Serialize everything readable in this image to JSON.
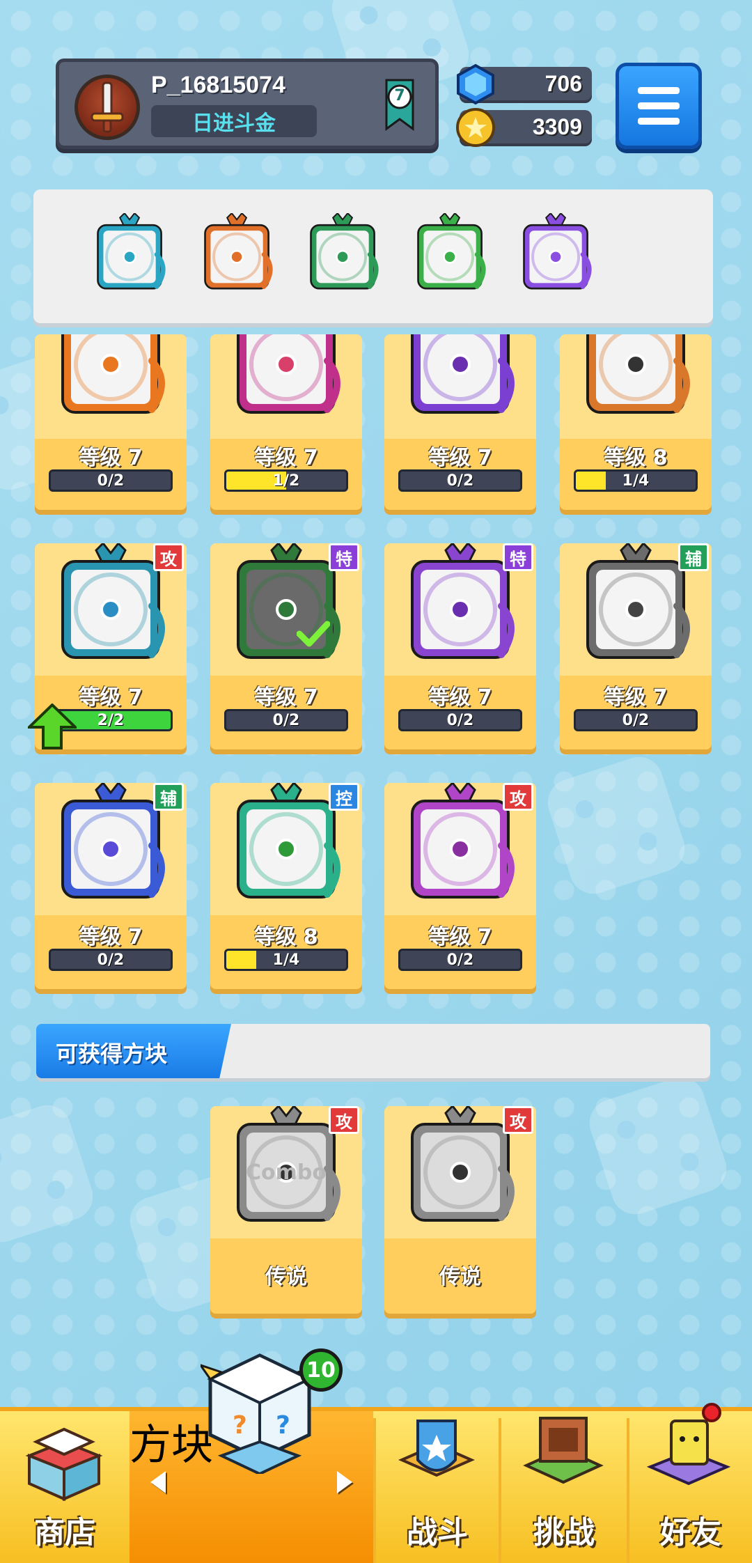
{
  "header": {
    "player_name": "P_16815074",
    "rank_title": "日进斗金",
    "rank_level": "7",
    "gems": "706",
    "coins": "3309"
  },
  "deck": {
    "slots": [
      {
        "name": "teal-dice",
        "color": "#2aa6c4"
      },
      {
        "name": "rainbow-dice",
        "color": "#e0702a"
      },
      {
        "name": "green-dice",
        "color": "#2e9a58"
      },
      {
        "name": "leaf-dice",
        "color": "#3bb048"
      },
      {
        "name": "purple-dice",
        "color": "#8a4ee0"
      }
    ]
  },
  "cards": [
    {
      "level": "等级 7",
      "progress": "0/2",
      "fill": 0,
      "frame": "#e9771f",
      "pip": "#e9771f"
    },
    {
      "level": "等级 7",
      "progress": "1/2",
      "fill": 0.5,
      "frame": "#c02f8a",
      "pip": "#d8406a"
    },
    {
      "level": "等级 7",
      "progress": "0/2",
      "fill": 0,
      "frame": "#7b3fd1",
      "pip": "#6a2fb0"
    },
    {
      "level": "等级 8",
      "progress": "1/4",
      "fill": 0.25,
      "frame": "#d9772a",
      "pip": "#333333"
    },
    {
      "level": "等级 7",
      "progress": "2/2",
      "fill": 1,
      "frame": "#2a95b0",
      "pip": "#2a8ec4",
      "tag": "攻",
      "tag_color": "#e23a3a",
      "upgrade": true
    },
    {
      "level": "等级 7",
      "progress": "0/2",
      "fill": 0,
      "frame": "#2f7a3a",
      "pip": "#2f7a3a",
      "tag": "特",
      "tag_color": "#8a3fd8",
      "selected": true
    },
    {
      "level": "等级 7",
      "progress": "0/2",
      "fill": 0,
      "frame": "#8a45d0",
      "pip": "#6a2fb0",
      "tag": "特",
      "tag_color": "#8a3fd8"
    },
    {
      "level": "等级 7",
      "progress": "0/2",
      "fill": 0,
      "frame": "#6c6c6c",
      "pip": "#444444",
      "tag": "辅",
      "tag_color": "#22a05a"
    },
    {
      "level": "等级 7",
      "progress": "0/2",
      "fill": 0,
      "frame": "#3a5ad6",
      "pip": "#5a4ad8",
      "tag": "辅",
      "tag_color": "#22a05a"
    },
    {
      "level": "等级 8",
      "progress": "1/4",
      "fill": 0.25,
      "frame": "#2ab08a",
      "pip": "#2f9a3a",
      "tag": "控",
      "tag_color": "#2a86e0"
    },
    {
      "level": "等级 7",
      "progress": "0/2",
      "fill": 0,
      "frame": "#b045c8",
      "pip": "#8a2fa0",
      "tag": "攻",
      "tag_color": "#e23a3a"
    }
  ],
  "obtainable": {
    "title": "可获得方块",
    "cards": [
      {
        "label": "传说",
        "tag": "攻",
        "tag_color": "#e23a3a",
        "art_text": "Combo"
      },
      {
        "label": "传说",
        "tag": "攻",
        "tag_color": "#e23a3a",
        "art_text": ""
      }
    ]
  },
  "nav": {
    "shop": "商店",
    "dice": "方块",
    "battle": "战斗",
    "challenge": "挑战",
    "friends": "好友",
    "dice_badge": "10"
  }
}
